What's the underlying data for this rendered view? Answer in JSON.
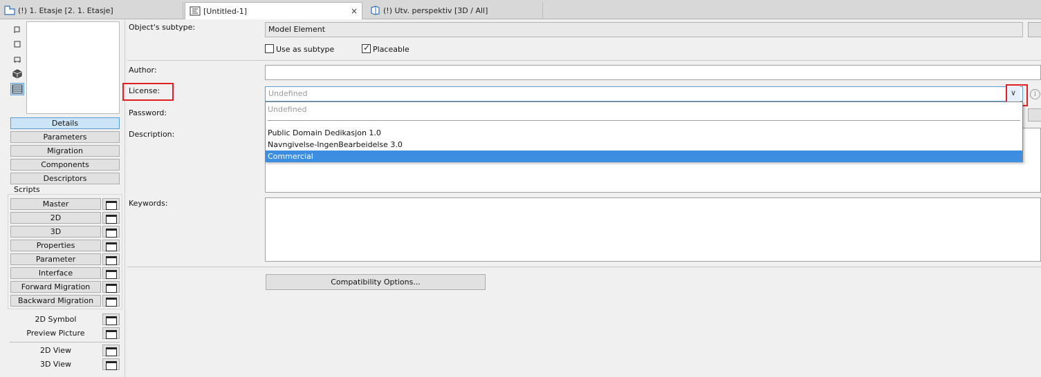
{
  "tabs": [
    {
      "label": "(!) 1. Etasje [2. 1. Etasje]",
      "icon": "floor-plan-icon"
    },
    {
      "label": "[Untitled-1]",
      "icon": "object-editor-icon",
      "close": "×"
    },
    {
      "label": "(!) Utv. perspektiv [3D / All]",
      "icon": "3d-window-icon"
    }
  ],
  "left_nav": {
    "items": [
      "Details",
      "Parameters",
      "Migration",
      "Components",
      "Descriptors"
    ],
    "selected": "Details"
  },
  "scripts": {
    "title": "Scripts",
    "items": [
      "Master",
      "2D",
      "3D",
      "Properties",
      "Parameter",
      "Interface",
      "Forward Migration",
      "Backward Migration"
    ]
  },
  "extras": {
    "group1": [
      "2D Symbol",
      "Preview Picture"
    ],
    "group2": [
      "2D View",
      "3D View"
    ]
  },
  "details": {
    "subtype_label": "Object's subtype:",
    "subtype_value": "Model Element",
    "use_as_subtype": "Use as subtype",
    "use_as_subtype_checked": false,
    "placeable": "Placeable",
    "placeable_checked": true,
    "author_label": "Author:",
    "author_value": "",
    "license_label": "License:",
    "license_value": "Undefined",
    "license_options": [
      "Undefined",
      "Public Domain Dedikasjon 1.0",
      "Navngivelse-IngenBearbeidelse 3.0",
      "Commercial"
    ],
    "license_highlighted": "Commercial",
    "password_label": "Password:",
    "description_label": "Description:",
    "keywords_label": "Keywords:",
    "compat_button": "Compatibility Options...",
    "info_icon": "i"
  },
  "colors": {
    "highlight": "#3d8ee0",
    "annotation": "#e02020",
    "selected_nav": "#cce4f7"
  }
}
